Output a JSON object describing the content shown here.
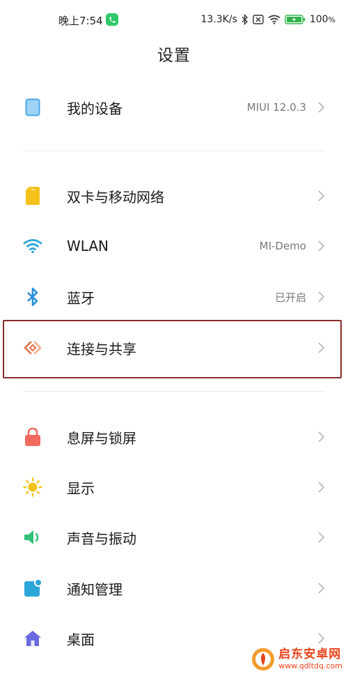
{
  "status_bar": {
    "time": "晚上7:54",
    "net_speed": "13.3K/s",
    "battery": "100",
    "battery_unit": "%"
  },
  "header": {
    "title": "设置"
  },
  "items": [
    {
      "label": "我的设备",
      "value": "MIUI 12.0.3",
      "icon": "tablet-icon",
      "color": "#4aa8e8"
    },
    {
      "label": "双卡与移动网络",
      "value": "",
      "icon": "sim-card-icon",
      "color": "#f5c21b"
    },
    {
      "label": "WLAN",
      "value": "MI-Demo",
      "icon": "wifi-icon",
      "color": "#2aa6d9"
    },
    {
      "label": "蓝牙",
      "value": "已开启",
      "icon": "bluetooth-icon",
      "color": "#2a8fd9"
    },
    {
      "label": "连接与共享",
      "value": "",
      "icon": "connection-share-icon",
      "color": "#e07a52"
    },
    {
      "label": "息屏与锁屏",
      "value": "",
      "icon": "lock-icon",
      "color": "#f06a5e"
    },
    {
      "label": "显示",
      "value": "",
      "icon": "sun-icon",
      "color": "#f5c21b"
    },
    {
      "label": "声音与振动",
      "value": "",
      "icon": "speaker-icon",
      "color": "#33c07a"
    },
    {
      "label": "通知管理",
      "value": "",
      "icon": "notification-icon",
      "color": "#2aa6d9"
    },
    {
      "label": "桌面",
      "value": "",
      "icon": "home-icon",
      "color": "#6a6ae0"
    }
  ],
  "watermark": {
    "name": "启东安卓网",
    "url": "www.qdltdq.com"
  }
}
